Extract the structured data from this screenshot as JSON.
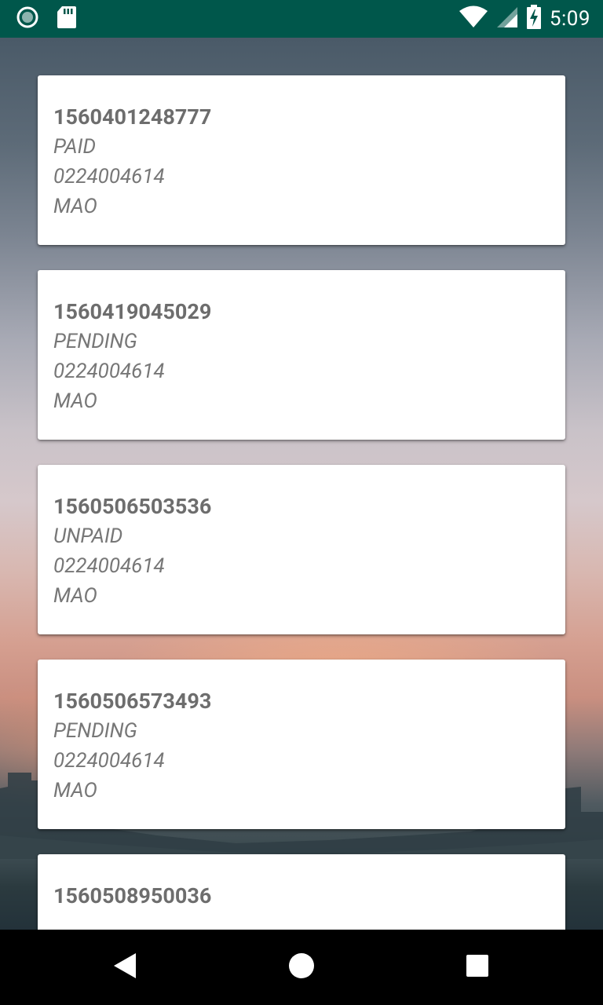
{
  "status_bar": {
    "time": "5:09",
    "icons_left": [
      "circle-notification-icon",
      "sd-card-icon"
    ],
    "icons_right": [
      "wifi-icon",
      "cell-signal-icon",
      "battery-charging-icon"
    ],
    "background": "#00574b"
  },
  "orders": [
    {
      "id": "1560401248777",
      "status": "PAID",
      "phone": "0224004614",
      "name": "MAO"
    },
    {
      "id": "1560419045029",
      "status": "PENDING",
      "phone": "0224004614",
      "name": "MAO"
    },
    {
      "id": "1560506503536",
      "status": "UNPAID",
      "phone": "0224004614",
      "name": "MAO"
    },
    {
      "id": "1560506573493",
      "status": "PENDING",
      "phone": "0224004614",
      "name": "MAO"
    },
    {
      "id": "1560508950036",
      "status": "",
      "phone": "",
      "name": ""
    }
  ],
  "nav_bar": {
    "back": "back-icon",
    "home": "home-icon",
    "recents": "recents-icon"
  }
}
